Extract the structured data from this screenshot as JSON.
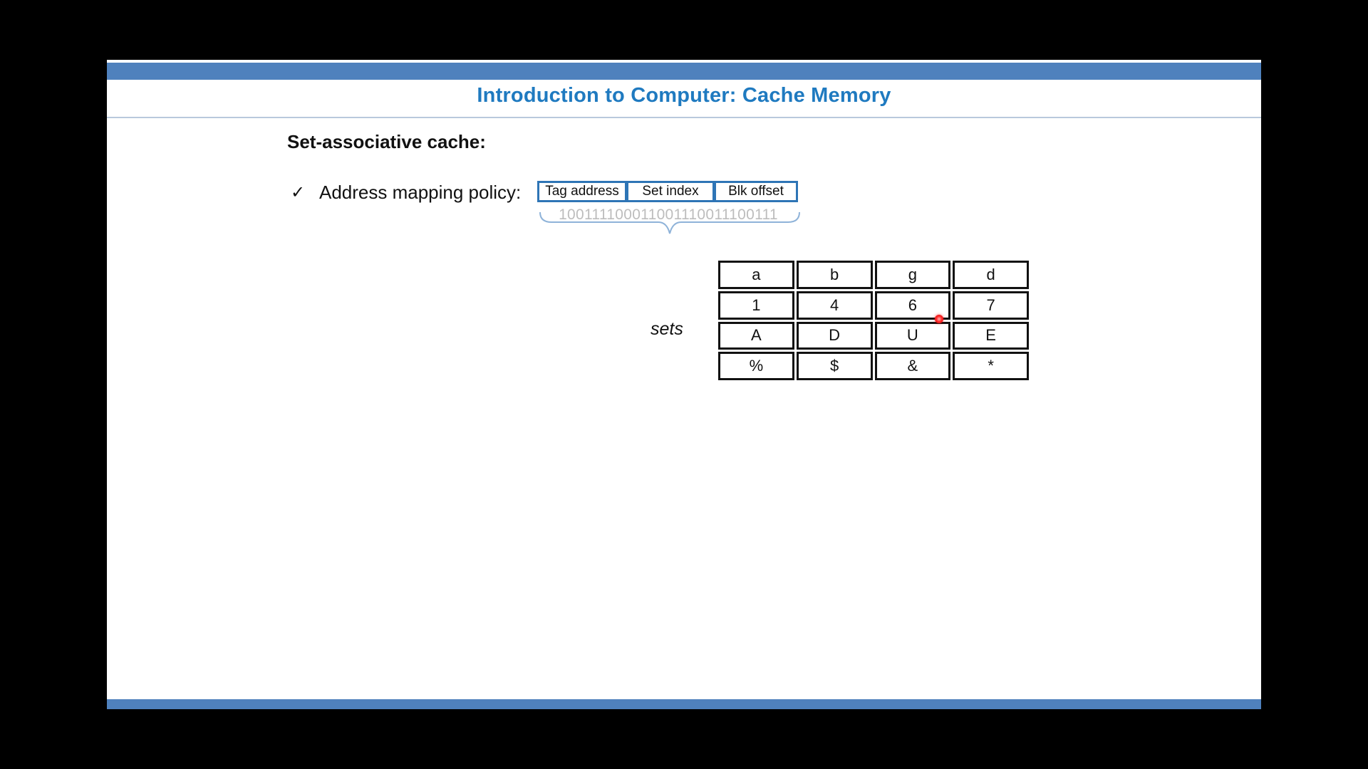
{
  "slide": {
    "title": "Introduction to Computer: Cache Memory",
    "heading": "Set-associative cache:",
    "bullet": {
      "check_glyph": "✓",
      "text": "Address mapping policy:"
    },
    "address_fields": [
      "Tag address",
      "Set index",
      "Blk offset"
    ],
    "address_binary": "100111100011001110011100111",
    "sets_label": "sets",
    "cache_rows": [
      [
        "a",
        "b",
        "g",
        "d"
      ],
      [
        "1",
        "4",
        "6",
        "7"
      ],
      [
        "A",
        "D",
        "U",
        "E"
      ],
      [
        "%",
        "$",
        "&",
        "*"
      ]
    ]
  },
  "colors": {
    "accent_bar": "#4f81bd",
    "title_text": "#1f7ac0",
    "field_border": "#2e75b6",
    "pointer": "#ff2a2a"
  }
}
